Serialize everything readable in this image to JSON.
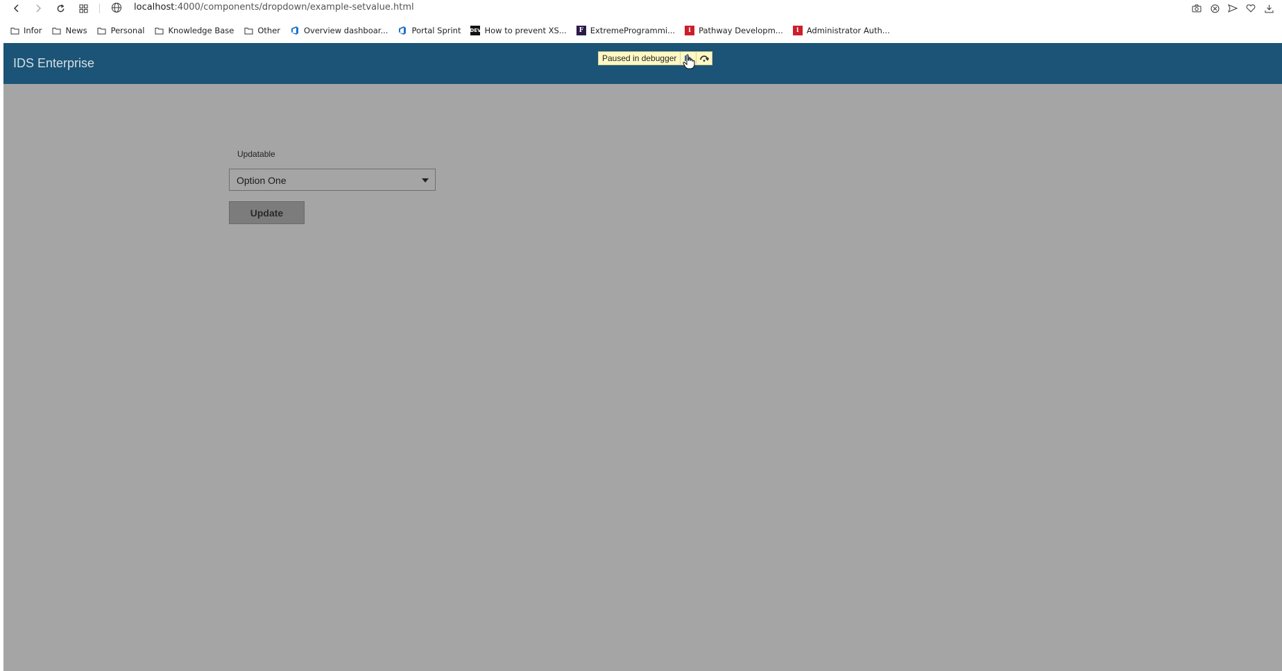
{
  "browser": {
    "url_host": "localhost",
    "url_path": ":4000/components/dropdown/example-setvalue.html"
  },
  "bookmarks": [
    {
      "label": "Infor",
      "icon": "folder-icon"
    },
    {
      "label": "News",
      "icon": "folder-icon"
    },
    {
      "label": "Personal",
      "icon": "folder-icon"
    },
    {
      "label": "Knowledge Base",
      "icon": "folder-icon"
    },
    {
      "label": "Other",
      "icon": "folder-icon"
    },
    {
      "label": "Overview dashboar...",
      "icon": "azure-devops-icon"
    },
    {
      "label": "Portal Sprint",
      "icon": "azure-devops-icon"
    },
    {
      "label": "How to prevent XS...",
      "icon": "dev-icon"
    },
    {
      "label": "ExtremeProgrammi...",
      "icon": "f-icon"
    },
    {
      "label": "Pathway Developm...",
      "icon": "infor-icon"
    },
    {
      "label": "Administrator Auth...",
      "icon": "infor-icon"
    }
  ],
  "header": {
    "title": "IDS Enterprise"
  },
  "debugger": {
    "label": "Paused in debugger"
  },
  "form": {
    "label": "Updatable",
    "selected": "Option One",
    "button_label": "Update"
  }
}
